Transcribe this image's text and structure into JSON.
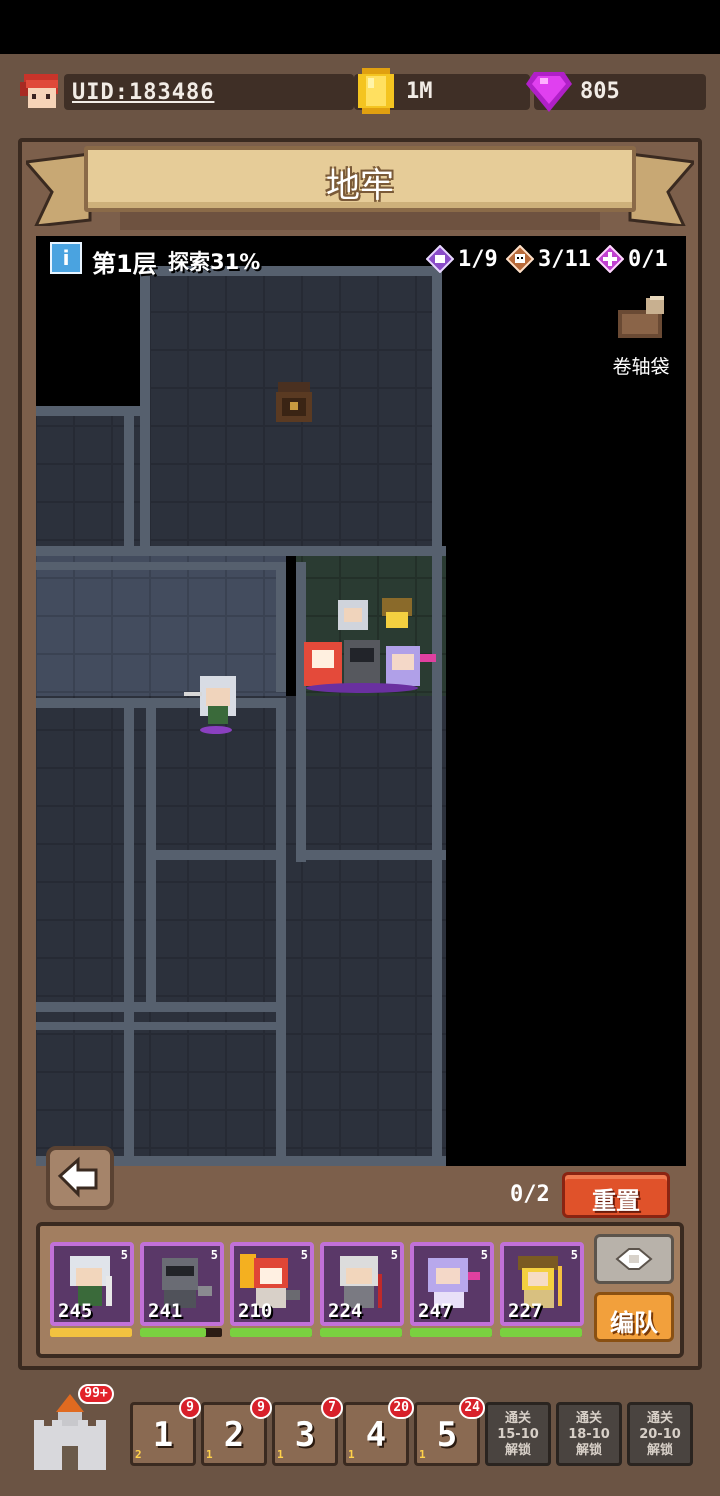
{
  "header": {
    "uid": "UID:183486",
    "gold": "1M",
    "gems": "805"
  },
  "dungeon": {
    "title": "地牢",
    "floor_label": "第1层",
    "explore_label": "探索31%",
    "counters": [
      {
        "icon": "chest-counter-icon",
        "value": "1/9",
        "color": "#8a4cc8"
      },
      {
        "icon": "skull-counter-icon",
        "value": "3/11",
        "color": "#b86a3a"
      },
      {
        "icon": "portal-counter-icon",
        "value": "0/1",
        "color": "#c040d0"
      }
    ],
    "scroll_bag_label": "卷轴袋"
  },
  "controls": {
    "progress": "0/2",
    "reset_label": "重置",
    "formation_label": "编队"
  },
  "team": [
    {
      "name": "silver-swordsman",
      "power": "245",
      "level": "5",
      "hp_color": "#f2c240",
      "hp_fraction": 1.0
    },
    {
      "name": "armored-knight",
      "power": "241",
      "level": "5",
      "hp_color": "#7ad040",
      "hp_fraction": 0.8
    },
    {
      "name": "flame-crusader",
      "power": "210",
      "level": "5",
      "hp_color": "#7ad040",
      "hp_fraction": 1.0
    },
    {
      "name": "elder-sage",
      "power": "224",
      "level": "5",
      "hp_color": "#7ad040",
      "hp_fraction": 1.0
    },
    {
      "name": "violet-priestess",
      "power": "247",
      "level": "5",
      "hp_color": "#7ad040",
      "hp_fraction": 1.0
    },
    {
      "name": "leaf-archer",
      "power": "227",
      "level": "5",
      "hp_color": "#7ad040",
      "hp_fraction": 1.0
    }
  ],
  "nav": {
    "castle_badge": "99+",
    "floors": [
      {
        "num": "1",
        "badge": "9",
        "chest": "2"
      },
      {
        "num": "2",
        "badge": "9",
        "chest": "1"
      },
      {
        "num": "3",
        "badge": "7",
        "chest": "1"
      },
      {
        "num": "4",
        "badge": "20",
        "chest": "1"
      },
      {
        "num": "5",
        "badge": "24",
        "chest": "1"
      }
    ],
    "locked": [
      "通关\n15-10\n解锁",
      "通关\n18-10\n解锁",
      "通关\n20-10\n解锁"
    ]
  }
}
